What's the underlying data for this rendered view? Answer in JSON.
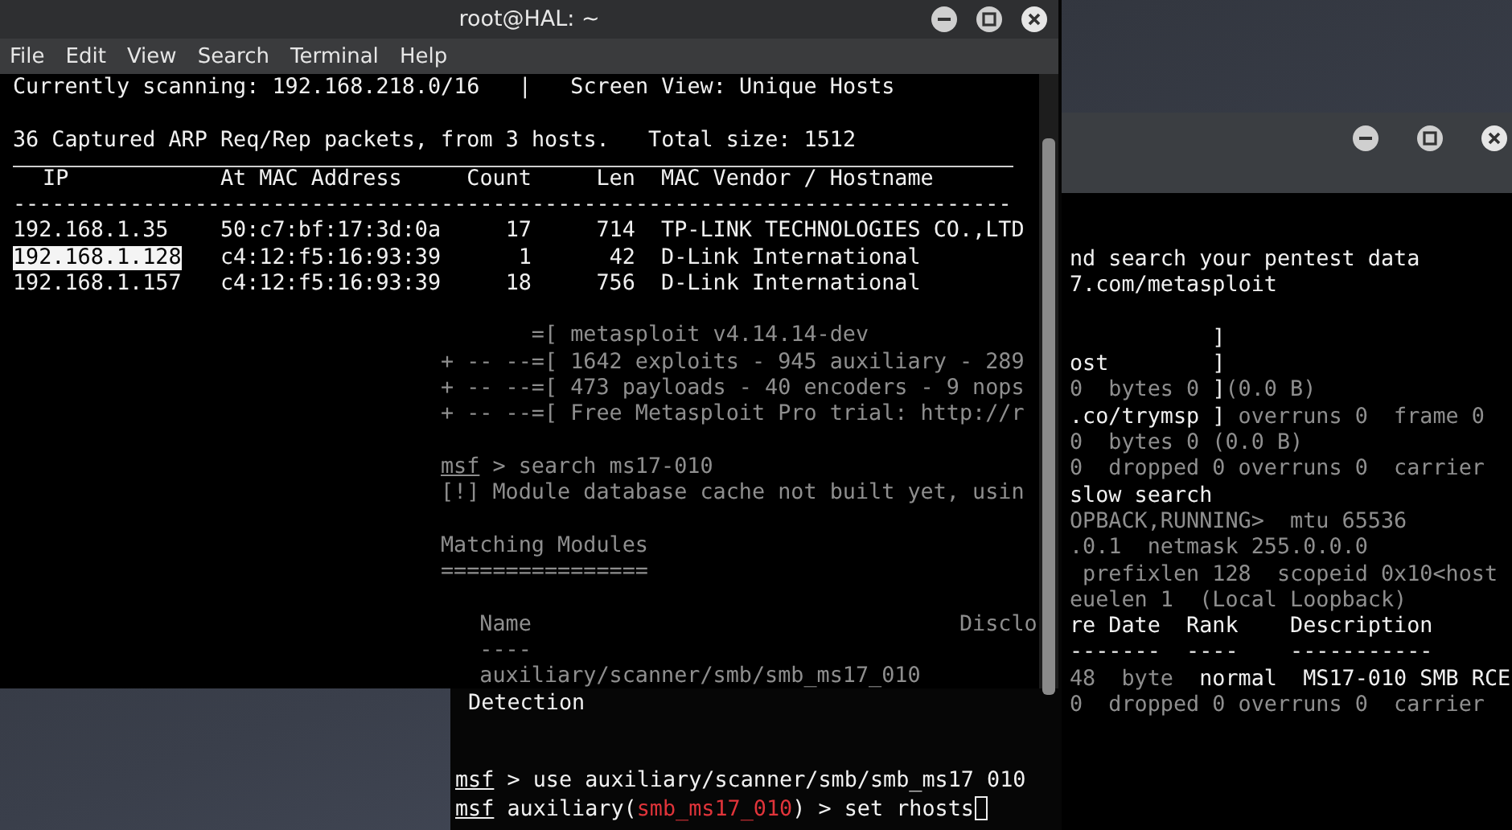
{
  "front_window": {
    "title": "root@HAL: ~",
    "menu": [
      "File",
      "Edit",
      "View",
      "Search",
      "Terminal",
      "Help"
    ],
    "header_blocks": [
      {
        "lines": [
          {
            "segments": [
              {
                "text": "Currently scanning: 192.168.218.0/16   |   Screen View: Unique Hosts",
                "kind": "plain"
              }
            ]
          }
        ]
      },
      {
        "lines": [
          {
            "segments": [
              {
                "text": "36 Captured ARP Req/Rep packets, from 3 hosts.   Total size: 1512",
                "kind": "plain"
              }
            ]
          }
        ]
      }
    ],
    "table": {
      "columns": [
        "IP",
        "At MAC Address",
        "Count",
        "Len",
        "MAC Vendor / Hostname"
      ],
      "separator": "-----------------------------------------------------------------------------",
      "rows": [
        {
          "ip": "192.168.1.35",
          "mac": "50:c7:bf:17:3d:0a",
          "count": "17",
          "len": "714",
          "vendor": "TP-LINK TECHNOLOGIES CO.,LTD",
          "selected": false
        },
        {
          "ip": "192.168.1.128",
          "mac": "c4:12:f5:16:93:39",
          "count": "1",
          "len": "42",
          "vendor": "D-Link International",
          "selected": true
        },
        {
          "ip": "192.168.1.157",
          "mac": "c4:12:f5:16:93:39",
          "count": "18",
          "len": "756",
          "vendor": "D-Link International",
          "selected": false
        }
      ]
    },
    "ghost_blocks": [
      {
        "lines": [
          {
            "segments": [
              {
                "text": "       =[ metasploit v4.14.14-dev",
                "kind": "faded"
              }
            ]
          },
          {
            "segments": [
              {
                "text": "+ -- --=[ 1642 exploits - 945 auxiliary - 289",
                "kind": "faded"
              }
            ]
          },
          {
            "segments": [
              {
                "text": "+ -- --=[ 473 payloads - 40 encoders - 9 nops",
                "kind": "faded"
              }
            ]
          },
          {
            "segments": [
              {
                "text": "+ -- --=[ Free Metasploit Pro trial: http://r",
                "kind": "faded"
              }
            ]
          }
        ]
      },
      {
        "lines": [
          {
            "segments": [
              {
                "text": "msf",
                "kind": "faded_prompt"
              },
              {
                "text": " > search ms17-010",
                "kind": "faded"
              }
            ]
          },
          {
            "segments": [
              {
                "text": "[!] Module database cache not built yet, usin",
                "kind": "faded"
              }
            ]
          }
        ]
      },
      {
        "lines": [
          {
            "segments": [
              {
                "text": "Matching Modules",
                "kind": "faded"
              }
            ]
          },
          {
            "segments": [
              {
                "text": "================",
                "kind": "faded"
              }
            ]
          }
        ]
      },
      {
        "lines": [
          {
            "segments": [
              {
                "text": "   Name                                 Disclo",
                "kind": "faded"
              }
            ]
          },
          {
            "segments": [
              {
                "text": "   ----",
                "kind": "faded"
              }
            ]
          },
          {
            "segments": [
              {
                "text": "   auxiliary/scanner/smb/smb_ms17_010",
                "kind": "faded"
              }
            ]
          }
        ]
      }
    ]
  },
  "msf_window": {
    "blocks": [
      {
        "lines": [
          {
            "segments": [
              {
                "text": " Detection",
                "kind": "plain"
              }
            ]
          }
        ]
      },
      {
        "lines": [
          {
            "segments": [
              {
                "text": "msf",
                "kind": "prompt"
              },
              {
                "text": " > use auxiliary/scanner/smb/smb_ms17 010",
                "kind": "plain"
              }
            ]
          },
          {
            "segments": [
              {
                "text": "msf",
                "kind": "prompt"
              },
              {
                "text": " auxiliary(",
                "kind": "plain"
              },
              {
                "text": "smb_ms17_010",
                "kind": "module"
              },
              {
                "text": ") > set rhosts",
                "kind": "plain"
              }
            ],
            "cursor": true
          }
        ]
      }
    ]
  },
  "right_window": {
    "blocks": [
      {
        "lines": [
          {
            "segments": [
              {
                "text": "nd search your pentest data",
                "kind": "plain"
              }
            ]
          },
          {
            "segments": [
              {
                "text": "7.com/metasploit",
                "kind": "plain"
              }
            ]
          }
        ]
      },
      {
        "lines": [
          {
            "segments": [
              {
                "text": "           ]",
                "kind": "plain"
              }
            ]
          },
          {
            "segments": [
              {
                "text": "ost        ]",
                "kind": "plain"
              }
            ]
          },
          {
            "segments": [
              {
                "text": "0  bytes 0 ",
                "kind": "faded"
              },
              {
                "text": "]",
                "kind": "plain"
              },
              {
                "text": "(0.0 B)",
                "kind": "faded"
              }
            ]
          },
          {
            "segments": [
              {
                "text": ".co/trymsp ]",
                "kind": "plain"
              },
              {
                "text": " overruns 0  frame 0",
                "kind": "faded"
              }
            ]
          },
          {
            "segments": [
              {
                "text": "0  bytes 0 (0.0 B)",
                "kind": "faded"
              }
            ]
          },
          {
            "segments": [
              {
                "text": "0  dropped 0 overruns 0  carrier",
                "kind": "faded"
              }
            ]
          },
          {
            "segments": [
              {
                "text": "slow search",
                "kind": "plain"
              }
            ]
          },
          {
            "segments": [
              {
                "text": "OPBACK,RUNNING>  mtu 65536",
                "kind": "faded"
              }
            ]
          },
          {
            "segments": [
              {
                "text": ".0.1  netmask 255.0.0.0",
                "kind": "faded"
              }
            ]
          },
          {
            "segments": [
              {
                "text": " prefixlen 128  scopeid 0x10<host",
                "kind": "faded"
              }
            ]
          },
          {
            "segments": [
              {
                "text": "euelen 1  (Local Loopback)",
                "kind": "faded"
              }
            ]
          },
          {
            "segments": [
              {
                "text": "re Date  Rank    Description",
                "kind": "plain"
              }
            ]
          },
          {
            "segments": [
              {
                "text": "-------  ----    -----------",
                "kind": "plain"
              }
            ]
          },
          {
            "segments": [
              {
                "text": "48  byte",
                "kind": "faded"
              },
              {
                "text": "  normal  MS17-010 SMB RCE",
                "kind": "plain"
              }
            ]
          },
          {
            "segments": [
              {
                "text": "0  dropped 0 overruns 0  carrier",
                "kind": "faded"
              }
            ]
          }
        ]
      }
    ]
  }
}
